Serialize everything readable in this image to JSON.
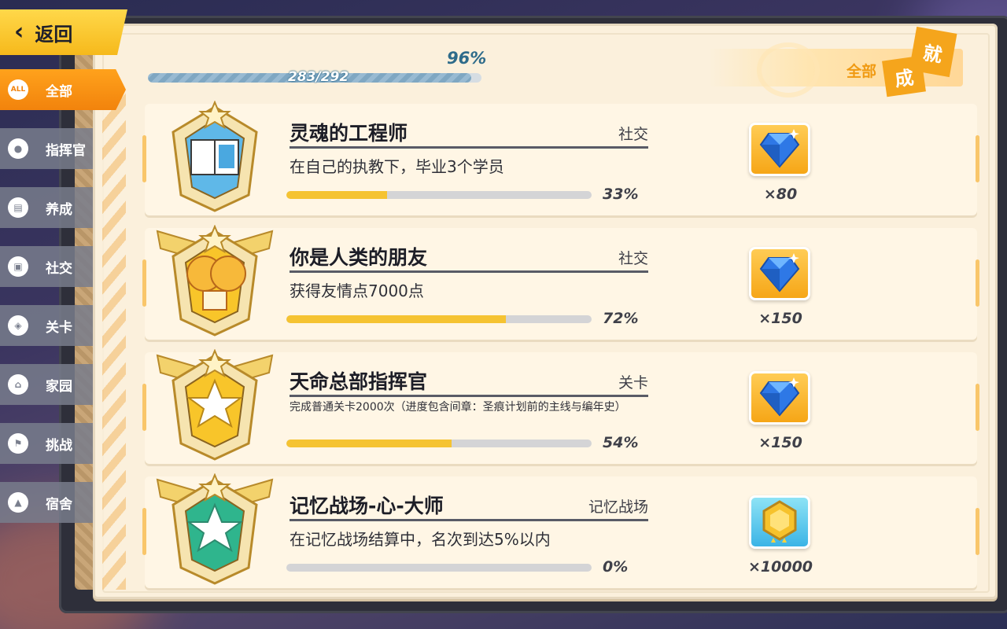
{
  "back": {
    "label": "返回"
  },
  "sidebar": {
    "items": [
      {
        "label": "全部",
        "icon": "all-icon",
        "icon_text": "ALL",
        "active": true
      },
      {
        "label": "指挥官",
        "icon": "user-icon",
        "icon_text": "●"
      },
      {
        "label": "养成",
        "icon": "card-icon",
        "icon_text": "▤"
      },
      {
        "label": "社交",
        "icon": "id-card-icon",
        "icon_text": "▣"
      },
      {
        "label": "关卡",
        "icon": "target-icon",
        "icon_text": "◈"
      },
      {
        "label": "家园",
        "icon": "home-icon",
        "icon_text": "⌂"
      },
      {
        "label": "挑战",
        "icon": "flag-icon",
        "icon_text": "⚑"
      },
      {
        "label": "宿舍",
        "icon": "room-icon",
        "icon_text": "▲"
      }
    ]
  },
  "progress": {
    "percent_label": "96%",
    "count_label": "283/292",
    "fraction": 0.969
  },
  "header": {
    "filter_label": "全部",
    "stamp_a": "成",
    "stamp_b": "就"
  },
  "achievements": [
    {
      "title": "灵魂的工程师",
      "category": "社交",
      "description": "在自己的执教下，毕业3个学员",
      "progress": 0.33,
      "progress_label": "33%",
      "reward_icon": "blue-crystal-icon",
      "reward_qty": "×80",
      "medal": "book-medal-icon"
    },
    {
      "title": "你是人类的朋友",
      "category": "社交",
      "description": "获得友情点7000点",
      "progress": 0.72,
      "progress_label": "72%",
      "reward_icon": "blue-crystal-icon",
      "reward_qty": "×150",
      "medal": "parachute-medal-icon"
    },
    {
      "title": "天命总部指挥官",
      "category": "关卡",
      "description": "完成普通关卡2000次（进度包含间章：圣痕计划前的主线与编年史）",
      "progress": 0.54,
      "progress_label": "54%",
      "reward_icon": "blue-crystal-icon",
      "reward_qty": "×150",
      "medal": "star-shield-medal-icon"
    },
    {
      "title": "记忆战场-心-大师",
      "category": "记忆战场",
      "description": "在记忆战场结算中，名次到达5%以内",
      "progress": 0.0,
      "progress_label": "0%",
      "reward_icon": "gold-coin-icon",
      "reward_qty": "×10000",
      "medal": "green-star-medal-icon"
    }
  ],
  "colors": {
    "accent": "#f5a51c",
    "progress_fill": "#f5c332",
    "crystal": "#2e78e6"
  }
}
